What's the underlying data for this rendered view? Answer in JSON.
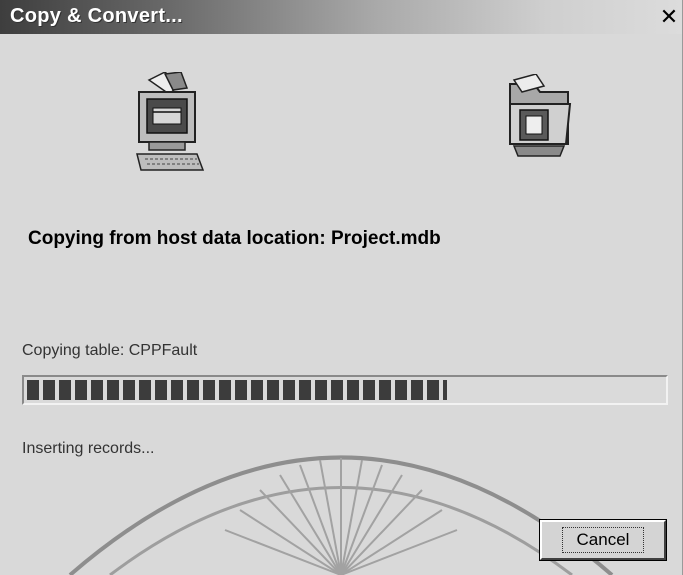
{
  "window": {
    "title": "Copy & Convert...",
    "close_symbol": "✕"
  },
  "icons": {
    "source": "computer-icon",
    "destination": "folder-icon"
  },
  "status": {
    "heading": "Copying from host data location: Project.mdb",
    "table_status": "Copying table: CPPFault",
    "record_status": "Inserting records..."
  },
  "progress": {
    "fraction": 0.66
  },
  "buttons": {
    "cancel_label": "Cancel"
  }
}
